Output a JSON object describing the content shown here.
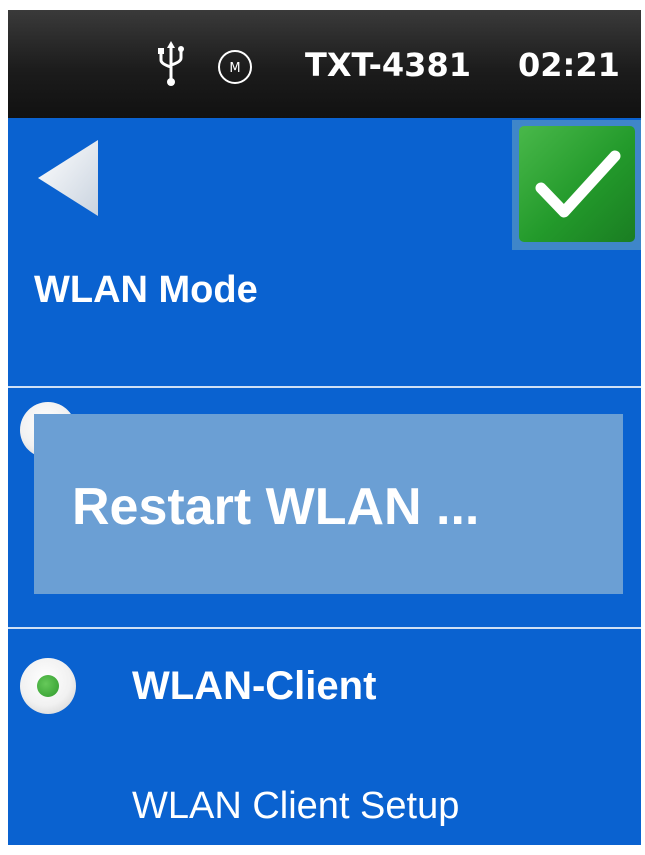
{
  "status_bar": {
    "usb_icon": "usb-icon",
    "mode_icon": "m-circle-icon",
    "mode_letter": "M",
    "device_name": "TXT-4381",
    "time": "02:21"
  },
  "header": {
    "back_icon": "back-arrow-icon",
    "confirm_icon": "checkmark-icon",
    "title": "WLAN Mode"
  },
  "dialog": {
    "message": "Restart WLAN ..."
  },
  "options": [
    {
      "label": "",
      "selected": false
    },
    {
      "label": "WLAN-Client",
      "selected": true
    }
  ],
  "client_setup": {
    "label": "WLAN Client Setup"
  },
  "colors": {
    "background": "#0a62d0",
    "status_bar": "#1c1c1c",
    "confirm": "#2aa32f",
    "dialog": "#6b9fd4",
    "radio_selected": "#3fa53a"
  }
}
